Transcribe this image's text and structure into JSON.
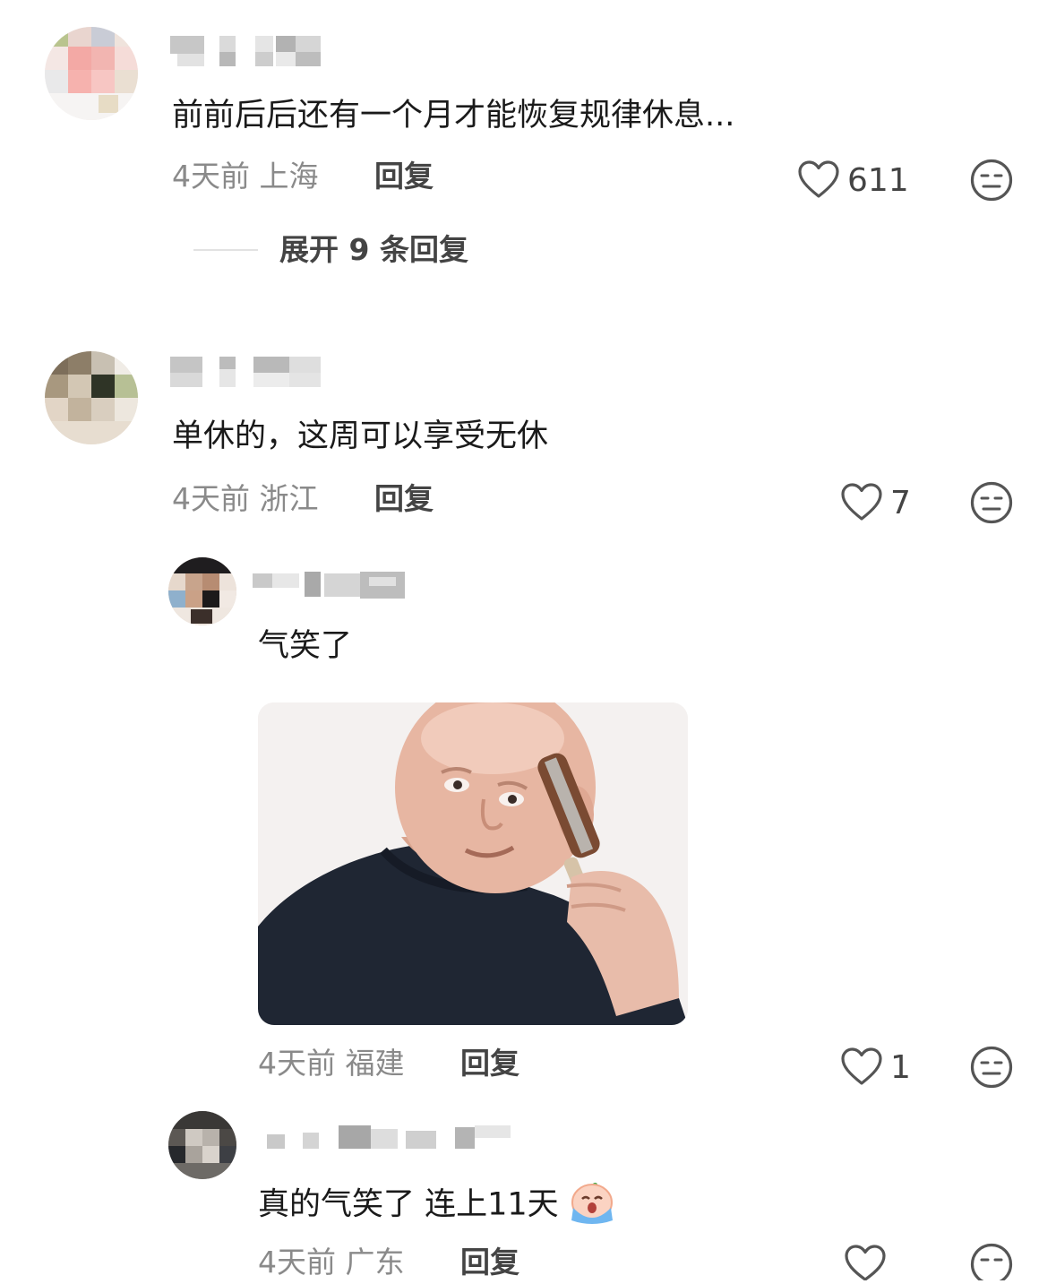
{
  "comments": [
    {
      "text": "前前后后还有一个月才能恢复规律休息...",
      "time": "4天前",
      "location": "上海",
      "reply_label": "回复",
      "likes": "611"
    },
    {
      "text": "单休的，这周可以享受无休",
      "time": "4天前",
      "location": "浙江",
      "reply_label": "回复",
      "likes": "7"
    }
  ],
  "expand_replies": "展开 9 条回复",
  "replies": [
    {
      "text": "气笑了",
      "time": "4天前",
      "location": "福建",
      "reply_label": "回复",
      "likes": "1",
      "sticker": "bald-man-brushing-head-sticker"
    },
    {
      "text": "真的气笑了 连上11天",
      "emoji": "crying-emoji",
      "time": "4天前",
      "location": "广东",
      "reply_label": "回复",
      "likes": ""
    }
  ],
  "colors": {
    "text": "#1a1a1a",
    "meta": "#8a8a8a",
    "icon": "#555555"
  }
}
